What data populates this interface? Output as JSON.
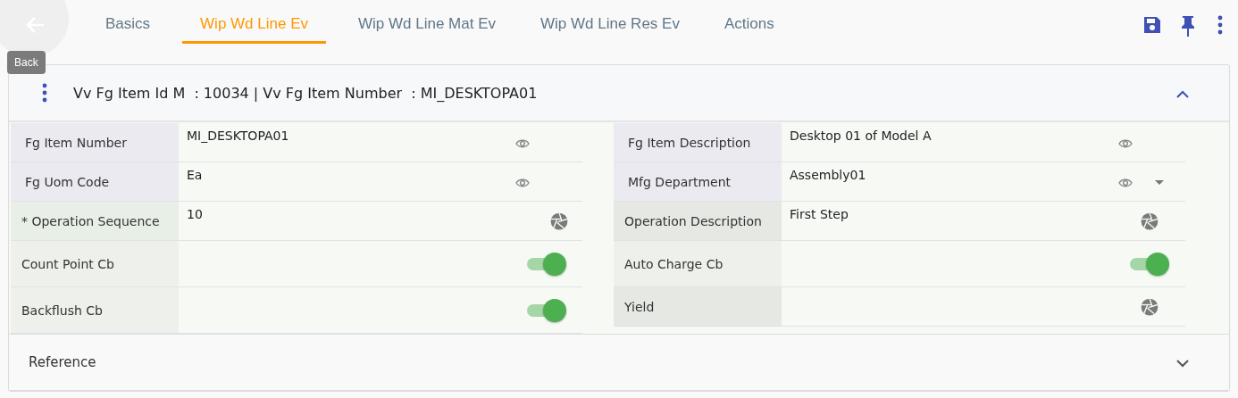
{
  "back": {
    "tooltip": "Back"
  },
  "tabs": [
    {
      "label": "Basics",
      "selected": false
    },
    {
      "label": "Wip Wd Line Ev",
      "selected": true
    },
    {
      "label": "Wip Wd Line Mat Ev",
      "selected": false
    },
    {
      "label": "Wip Wd Line Res Ev",
      "selected": false
    },
    {
      "label": "Actions",
      "selected": false
    }
  ],
  "header": {
    "title": "Vv Fg Item Id M  : 10034 | Vv Fg Item Number  : MI_DESKTOPA01",
    "expanded": true
  },
  "columns": [
    [
      {
        "kind": "readonly",
        "label": "Fg Item Number",
        "value": "MI_DESKTOPA01"
      },
      {
        "kind": "readonly",
        "label": "Fg Uom Code",
        "value": "Ea"
      },
      {
        "kind": "required",
        "label": "* Operation Sequence",
        "value": "10"
      },
      {
        "kind": "toggle",
        "label": "Count Point Cb",
        "on": true
      },
      {
        "kind": "toggle",
        "label": "Backflush Cb",
        "on": true
      }
    ],
    [
      {
        "kind": "readonly",
        "label": "Fg Item Description",
        "value": "Desktop 01 of Model A"
      },
      {
        "kind": "readonly",
        "label": "Mfg Department",
        "value": "Assembly01",
        "dropdown": true
      },
      {
        "kind": "input",
        "label": "Operation Description",
        "value": "First Step"
      },
      {
        "kind": "toggle",
        "label": "Auto Charge Cb",
        "on": true
      },
      {
        "kind": "input",
        "label": "Yield"
      }
    ]
  ],
  "reference": {
    "title": "Reference",
    "expanded": false
  }
}
